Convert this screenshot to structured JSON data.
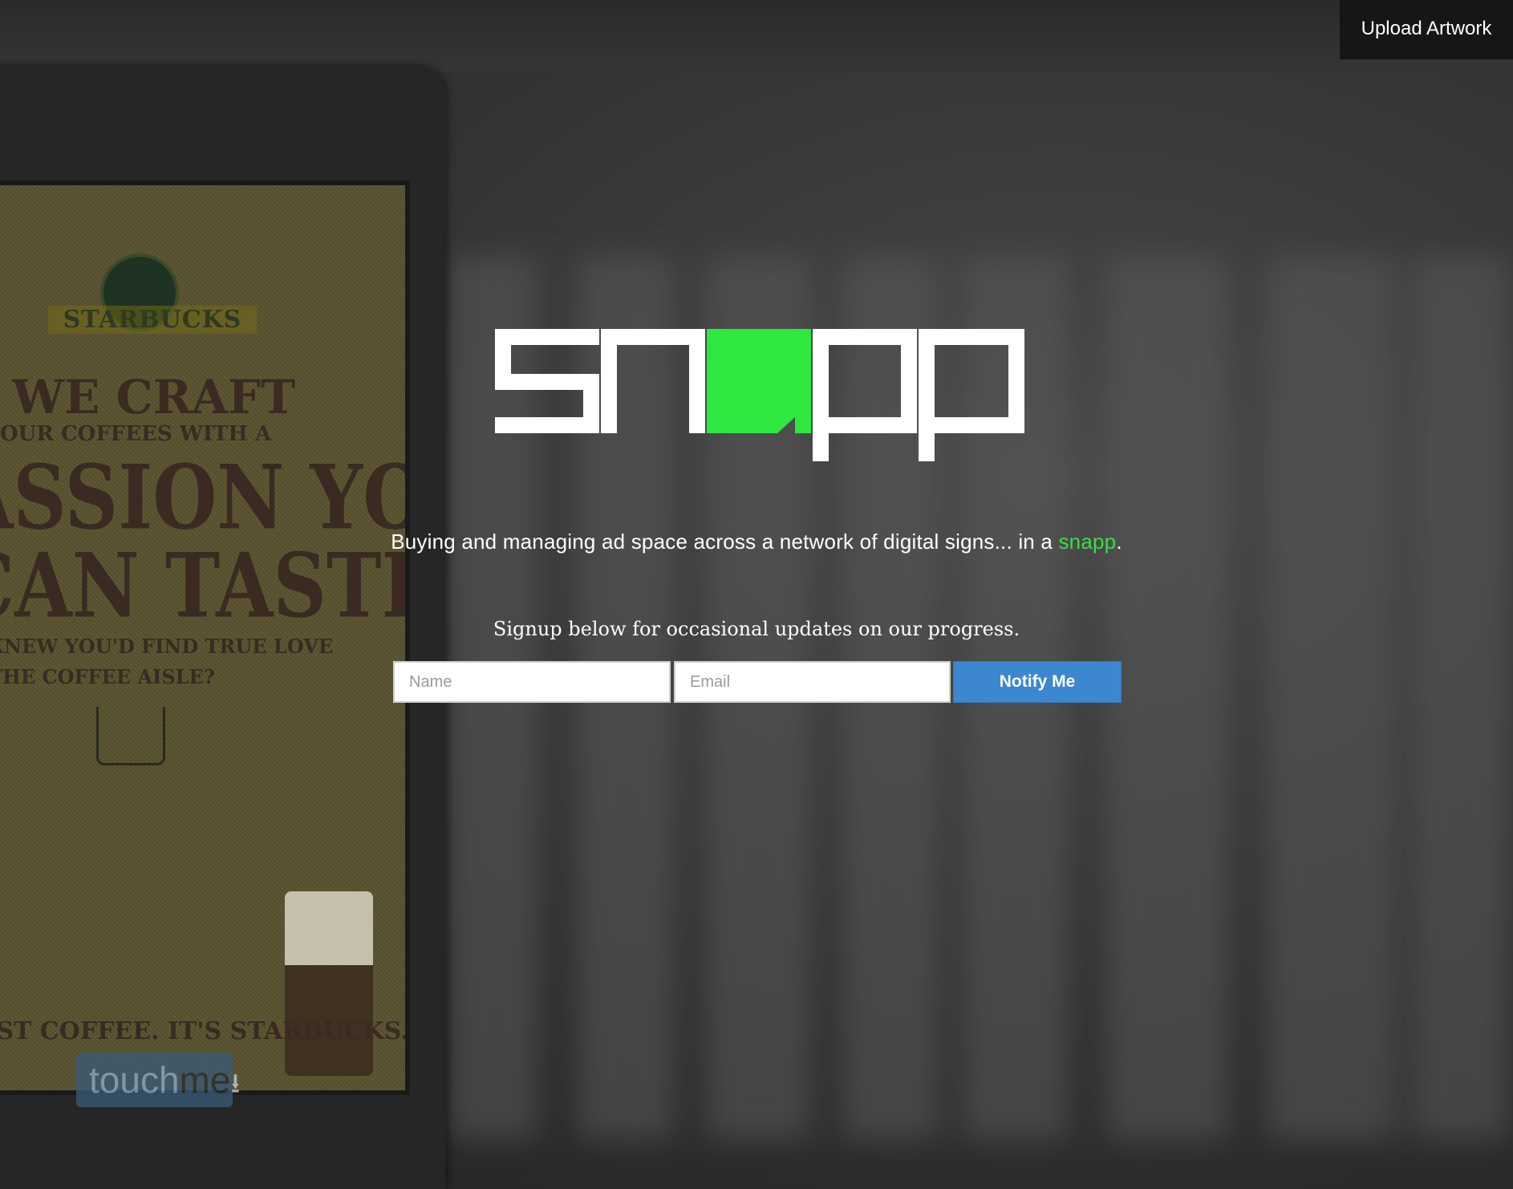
{
  "header": {
    "upload_label": "Upload Artwork"
  },
  "brand": {
    "logo_text": "snapp",
    "accent_color": "#2ee83f"
  },
  "hero": {
    "tagline_prefix": "Buying and managing ad space across a network of digital signs... in a ",
    "tagline_accent": "snapp",
    "tagline_suffix": "."
  },
  "signup": {
    "prompt": "Signup below for occasional updates on our progress.",
    "name_placeholder": "Name",
    "email_placeholder": "Email",
    "submit_label": "Notify Me",
    "button_color": "#3c87d0"
  },
  "background": {
    "poster": {
      "brand": "STARBUCKS",
      "line1": "WE CRAFT",
      "line2": "OUR COFFEES WITH A",
      "line3": "ASSION YOU",
      "line4": "CAN TASTE.",
      "line5": "O KNEW YOU'D FIND TRUE LOVE",
      "line6": "N THE COFFEE AISLE?",
      "line7": "JUST COFFEE. IT'S STARBUCKS."
    },
    "kiosk_button_prefix": "touch",
    "kiosk_button_suffix": "me"
  }
}
